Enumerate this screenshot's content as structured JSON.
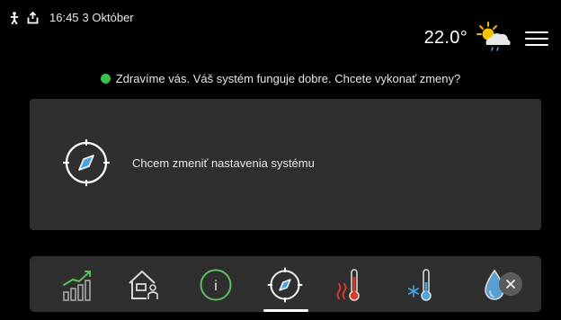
{
  "status": {
    "time": "16:45",
    "date": "3 Október",
    "temperature": "22.0°"
  },
  "icons": {
    "left": [
      "person-icon",
      "upload-icon"
    ],
    "weather": "partly-sunny-rain-icon",
    "menu": "hamburger-menu-icon"
  },
  "message": {
    "text": "Zdravíme vás. Váš systém funguje dobre. Chcete vykonať zmeny?",
    "indicator_color": "#37c24a"
  },
  "panel": {
    "action_label": "Chcem zmeniť nastavenia systému",
    "icon": "compass-icon"
  },
  "dock": {
    "items": [
      {
        "icon": "energy-bars-icon"
      },
      {
        "icon": "house-person-icon"
      },
      {
        "icon": "info-icon",
        "glyph": "i"
      },
      {
        "icon": "compass-icon",
        "selected": true
      },
      {
        "icon": "heating-thermometer-icon"
      },
      {
        "icon": "cooling-thermometer-icon"
      },
      {
        "icon": "water-drop-icon"
      }
    ],
    "close_icon": "close-icon"
  },
  "colors": {
    "background": "#000000",
    "panel": "#2f2f2f",
    "accent_green": "#37c24a",
    "heating_red": "#d93b2b",
    "cooling_blue": "#4aa6e0"
  }
}
